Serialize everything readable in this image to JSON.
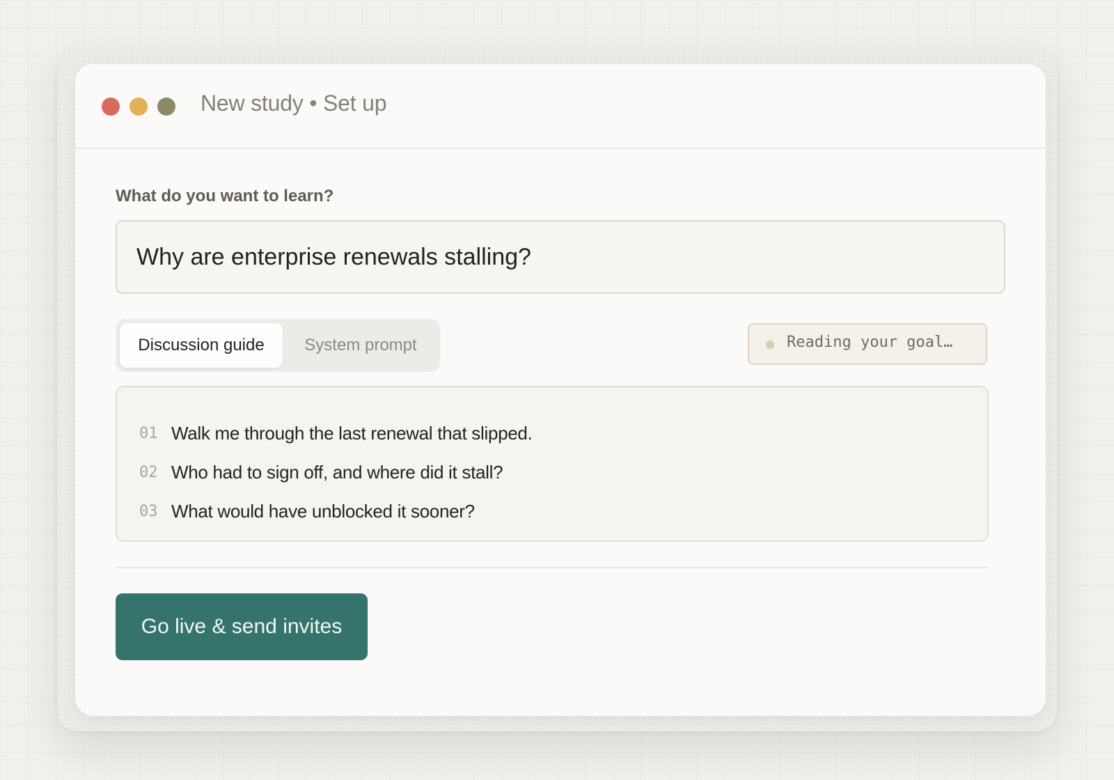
{
  "window": {
    "title": "New study • Set up"
  },
  "goal": {
    "label": "What do you want to learn?",
    "value": "Why are enterprise renewals stalling?"
  },
  "tabs": [
    {
      "label": "Discussion guide",
      "active": true
    },
    {
      "label": "System prompt",
      "active": false
    }
  ],
  "status": {
    "text": "Reading your goal…"
  },
  "guide": {
    "questions": [
      {
        "num": "01",
        "text": "Walk me through the last renewal that slipped."
      },
      {
        "num": "02",
        "text": "Who had to sign off, and where did it stall?"
      },
      {
        "num": "03",
        "text": "What would have unblocked it sooner?"
      }
    ]
  },
  "actions": {
    "go_live_label": "Go live & send invites"
  },
  "colors": {
    "accent": "#35746c",
    "close": "#d86a5b",
    "minimize": "#e3b257",
    "maximize": "#8c8a66"
  }
}
